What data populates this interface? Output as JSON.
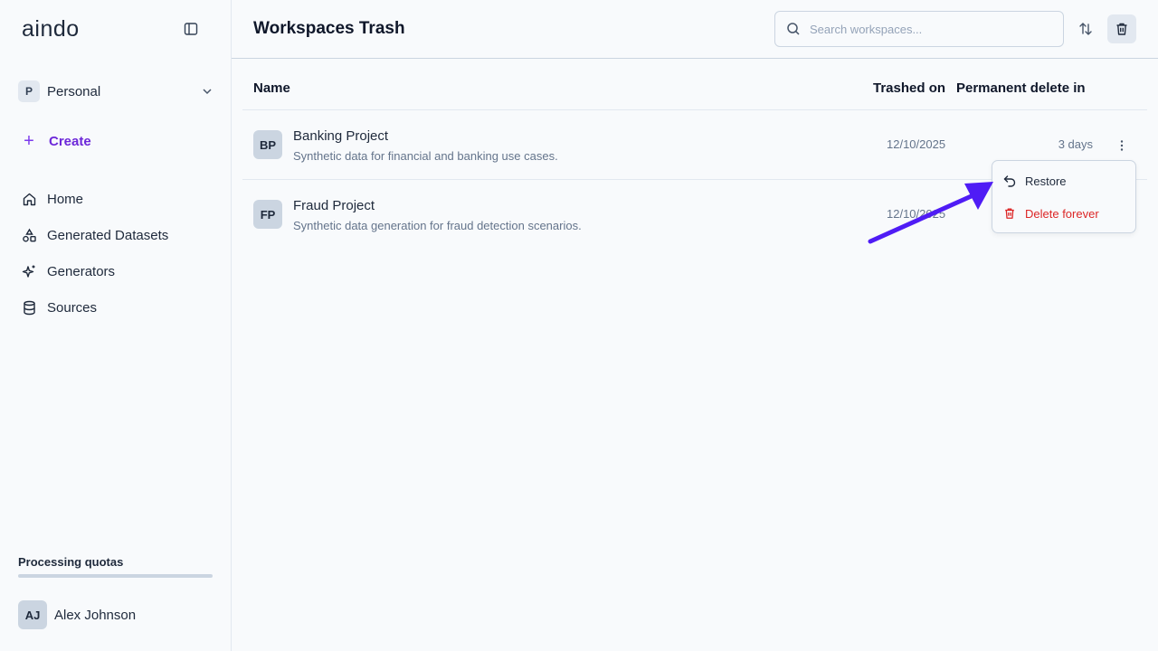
{
  "app": {
    "logo": "aindo"
  },
  "sidebar": {
    "workspace": {
      "badge": "P",
      "name": "Personal"
    },
    "create_label": "Create",
    "nav": [
      {
        "label": "Home",
        "icon": "home-icon"
      },
      {
        "label": "Generated Datasets",
        "icon": "shapes-icon"
      },
      {
        "label": "Generators",
        "icon": "sparkles-icon"
      },
      {
        "label": "Sources",
        "icon": "database-icon"
      }
    ],
    "quota_label": "Processing quotas",
    "user": {
      "initials": "AJ",
      "name": "Alex Johnson"
    }
  },
  "header": {
    "title": "Workspaces Trash",
    "search_placeholder": "Search workspaces..."
  },
  "table": {
    "columns": {
      "name": "Name",
      "trashed_on": "Trashed on",
      "delete_in": "Permanent delete in"
    },
    "rows": [
      {
        "initials": "BP",
        "name": "Banking Project",
        "description": "Synthetic data for financial and banking use cases.",
        "trashed_on": "12/10/2025",
        "delete_in": "3 days"
      },
      {
        "initials": "FP",
        "name": "Fraud Project",
        "description": "Synthetic data generation for fraud detection scenarios.",
        "trashed_on": "12/10/2025",
        "delete_in": ""
      }
    ]
  },
  "context_menu": {
    "restore_label": "Restore",
    "delete_label": "Delete forever"
  },
  "colors": {
    "accent": "#6d28d9",
    "danger": "#dc2626",
    "annotation_arrow": "#4f1cf5"
  }
}
